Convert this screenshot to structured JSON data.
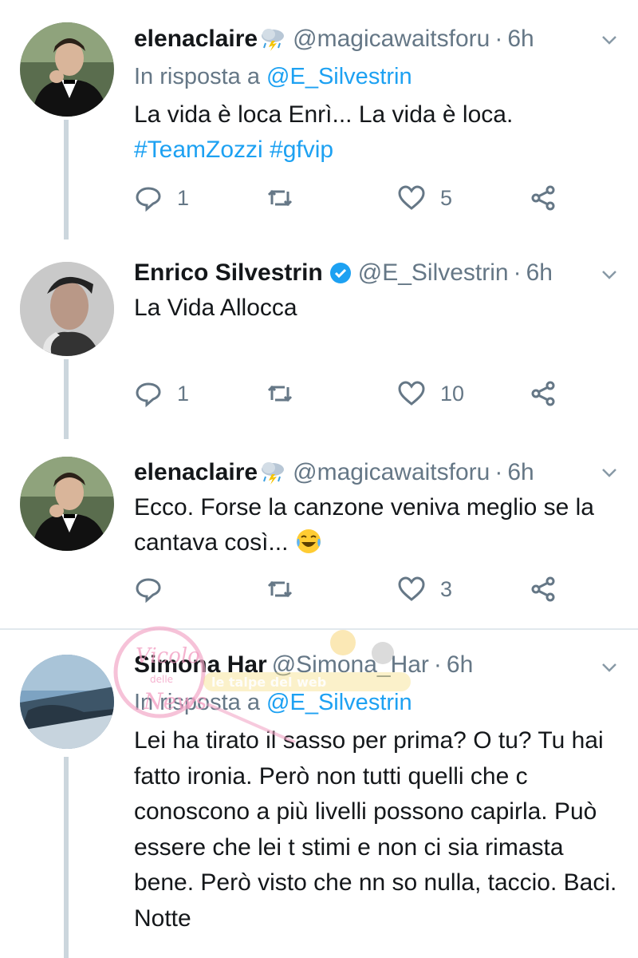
{
  "tweets": [
    {
      "name": "elenaclaire",
      "handle": "@magicawaitsforu",
      "dot": "·",
      "time": "6h",
      "reply_prefix": "In risposta a",
      "reply_mention": "@E_Silvestrin",
      "text_line1": "La vida è loca Enrì... La vida è loca.",
      "hashtag1": "#TeamZozzi",
      "hashtag2": "#gfvip",
      "reply_count": "1",
      "retweet_count": "",
      "like_count": "5"
    },
    {
      "name": "Enrico Silvestrin",
      "handle": "@E_Silvestrin",
      "dot": "·",
      "time": "6h",
      "text": "La Vida Allocca",
      "reply_count": "1",
      "retweet_count": "",
      "like_count": "10"
    },
    {
      "name": "elenaclaire",
      "handle": "@magicawaitsforu",
      "dot": "·",
      "time": "6h",
      "text": "Ecco. Forse la canzone veniva meglio se la cantava così...",
      "reply_count": "",
      "retweet_count": "",
      "like_count": "3"
    },
    {
      "name": "Simona Har",
      "handle": "@Simona_Har",
      "dot": "·",
      "time": "6h",
      "reply_prefix": "In risposta a",
      "reply_mention": "@E_Silvestrin",
      "text": "Lei ha tirato il sasso per prima? O tu? Tu hai fatto ironia. Però non tutti quelli che c conoscono a più livelli possono capirla. Può essere che lei t stimi e non ci sia rimasta bene. Però visto che nn so nulla, taccio. Baci. Notte"
    }
  ],
  "watermark": {
    "line1": "Vicolo",
    "line2": "delle",
    "line3": "News",
    "banner": "le talpe del web"
  },
  "colors": {
    "accent": "#1da1f2",
    "muted": "#657786",
    "line": "#ccd6dd"
  }
}
